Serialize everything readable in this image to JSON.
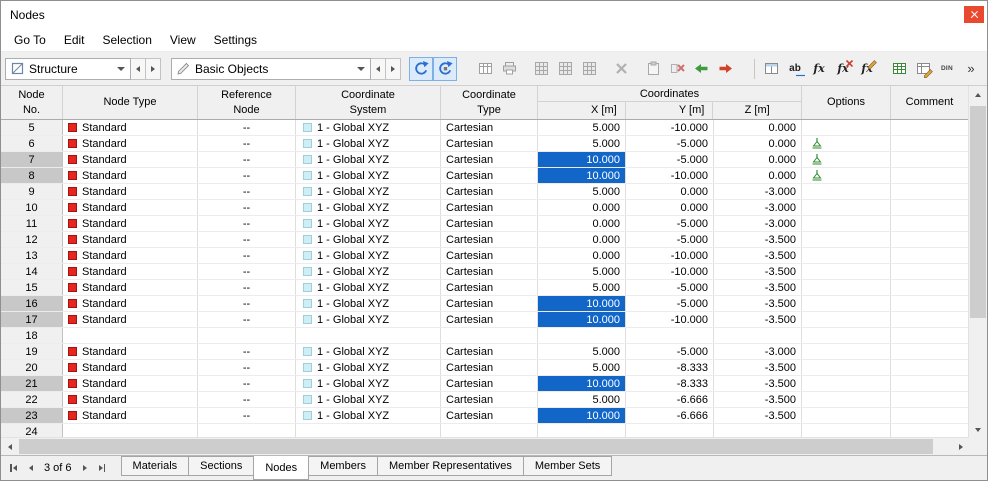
{
  "window": {
    "title": "Nodes"
  },
  "menu": {
    "items": [
      "Go To",
      "Edit",
      "Selection",
      "View",
      "Settings"
    ]
  },
  "toolbar": {
    "structure_select": {
      "value": "Structure"
    },
    "objects_select": {
      "value": "Basic Objects"
    },
    "glyphs": {
      "rename": "ab",
      "formula": "fx",
      "din": "DIN",
      "overflow": "»"
    },
    "icon_names": [
      "sync-selection",
      "sync-view",
      "table-layout",
      "print",
      "grid-block-1",
      "grid-block-2",
      "grid-block-3",
      "clear",
      "paste",
      "delete-rows",
      "import-rows",
      "export-rows",
      "split-table",
      "rename",
      "formula",
      "formula-delete",
      "formula-edit",
      "excel-export",
      "table-edit",
      "din",
      "overflow"
    ]
  },
  "table": {
    "header": {
      "node_no": [
        "Node",
        "No."
      ],
      "node_type": "Node Type",
      "reference_node": [
        "Reference",
        "Node"
      ],
      "coordinate_system": [
        "Coordinate",
        "System"
      ],
      "coordinate_type": [
        "Coordinate",
        "Type"
      ],
      "coordinates_group": "Coordinates",
      "x": "X [m]",
      "y": "Y [m]",
      "z": "Z [m]",
      "options": "Options",
      "comment": "Comment"
    },
    "rows": [
      {
        "no": "5",
        "type": "Standard",
        "ref": "--",
        "system": "1 - Global XYZ",
        "ctype": "Cartesian",
        "x": "5.000",
        "y": "-10.000",
        "z": "0.000",
        "xsel": false,
        "opt": false,
        "sel": false
      },
      {
        "no": "6",
        "type": "Standard",
        "ref": "--",
        "system": "1 - Global XYZ",
        "ctype": "Cartesian",
        "x": "5.000",
        "y": "-5.000",
        "z": "0.000",
        "xsel": false,
        "opt": true,
        "sel": false
      },
      {
        "no": "7",
        "type": "Standard",
        "ref": "--",
        "system": "1 - Global XYZ",
        "ctype": "Cartesian",
        "x": "10.000",
        "y": "-5.000",
        "z": "0.000",
        "xsel": true,
        "opt": true,
        "sel": true
      },
      {
        "no": "8",
        "type": "Standard",
        "ref": "--",
        "system": "1 - Global XYZ",
        "ctype": "Cartesian",
        "x": "10.000",
        "y": "-10.000",
        "z": "0.000",
        "xsel": true,
        "opt": true,
        "sel": true
      },
      {
        "no": "9",
        "type": "Standard",
        "ref": "--",
        "system": "1 - Global XYZ",
        "ctype": "Cartesian",
        "x": "5.000",
        "y": "0.000",
        "z": "-3.000",
        "xsel": false,
        "opt": false,
        "sel": false
      },
      {
        "no": "10",
        "type": "Standard",
        "ref": "--",
        "system": "1 - Global XYZ",
        "ctype": "Cartesian",
        "x": "0.000",
        "y": "0.000",
        "z": "-3.000",
        "xsel": false,
        "opt": false,
        "sel": false
      },
      {
        "no": "11",
        "type": "Standard",
        "ref": "--",
        "system": "1 - Global XYZ",
        "ctype": "Cartesian",
        "x": "0.000",
        "y": "-5.000",
        "z": "-3.000",
        "xsel": false,
        "opt": false,
        "sel": false
      },
      {
        "no": "12",
        "type": "Standard",
        "ref": "--",
        "system": "1 - Global XYZ",
        "ctype": "Cartesian",
        "x": "0.000",
        "y": "-5.000",
        "z": "-3.500",
        "xsel": false,
        "opt": false,
        "sel": false
      },
      {
        "no": "13",
        "type": "Standard",
        "ref": "--",
        "system": "1 - Global XYZ",
        "ctype": "Cartesian",
        "x": "0.000",
        "y": "-10.000",
        "z": "-3.500",
        "xsel": false,
        "opt": false,
        "sel": false
      },
      {
        "no": "14",
        "type": "Standard",
        "ref": "--",
        "system": "1 - Global XYZ",
        "ctype": "Cartesian",
        "x": "5.000",
        "y": "-10.000",
        "z": "-3.500",
        "xsel": false,
        "opt": false,
        "sel": false
      },
      {
        "no": "15",
        "type": "Standard",
        "ref": "--",
        "system": "1 - Global XYZ",
        "ctype": "Cartesian",
        "x": "5.000",
        "y": "-5.000",
        "z": "-3.500",
        "xsel": false,
        "opt": false,
        "sel": false
      },
      {
        "no": "16",
        "type": "Standard",
        "ref": "--",
        "system": "1 - Global XYZ",
        "ctype": "Cartesian",
        "x": "10.000",
        "y": "-5.000",
        "z": "-3.500",
        "xsel": true,
        "opt": false,
        "sel": true
      },
      {
        "no": "17",
        "type": "Standard",
        "ref": "--",
        "system": "1 - Global XYZ",
        "ctype": "Cartesian",
        "x": "10.000",
        "y": "-10.000",
        "z": "-3.500",
        "xsel": true,
        "opt": false,
        "sel": true
      },
      {
        "no": "18",
        "type": "",
        "ref": "",
        "system": "",
        "ctype": "",
        "x": "",
        "y": "",
        "z": "",
        "xsel": false,
        "opt": false,
        "sel": false
      },
      {
        "no": "19",
        "type": "Standard",
        "ref": "--",
        "system": "1 - Global XYZ",
        "ctype": "Cartesian",
        "x": "5.000",
        "y": "-5.000",
        "z": "-3.000",
        "xsel": false,
        "opt": false,
        "sel": false
      },
      {
        "no": "20",
        "type": "Standard",
        "ref": "--",
        "system": "1 - Global XYZ",
        "ctype": "Cartesian",
        "x": "5.000",
        "y": "-8.333",
        "z": "-3.500",
        "xsel": false,
        "opt": false,
        "sel": false
      },
      {
        "no": "21",
        "type": "Standard",
        "ref": "--",
        "system": "1 - Global XYZ",
        "ctype": "Cartesian",
        "x": "10.000",
        "y": "-8.333",
        "z": "-3.500",
        "xsel": true,
        "opt": false,
        "sel": true
      },
      {
        "no": "22",
        "type": "Standard",
        "ref": "--",
        "system": "1 - Global XYZ",
        "ctype": "Cartesian",
        "x": "5.000",
        "y": "-6.666",
        "z": "-3.500",
        "xsel": false,
        "opt": false,
        "sel": false
      },
      {
        "no": "23",
        "type": "Standard",
        "ref": "--",
        "system": "1 - Global XYZ",
        "ctype": "Cartesian",
        "x": "10.000",
        "y": "-6.666",
        "z": "-3.500",
        "xsel": true,
        "opt": false,
        "sel": true
      },
      {
        "no": "24",
        "type": "",
        "ref": "",
        "system": "",
        "ctype": "",
        "x": "",
        "y": "",
        "z": "",
        "xsel": false,
        "opt": false,
        "sel": false
      }
    ]
  },
  "bottom": {
    "position": "3 of 6",
    "tabs": [
      {
        "label": "Materials",
        "active": false
      },
      {
        "label": "Sections",
        "active": false
      },
      {
        "label": "Nodes",
        "active": true
      },
      {
        "label": "Members",
        "active": false
      },
      {
        "label": "Member Representatives",
        "active": false
      },
      {
        "label": "Member Sets",
        "active": false
      }
    ]
  },
  "colors": {
    "selection_blue": "#1166c8",
    "node_type_red": "#e8251d",
    "coordinate_system_cyan": "#cdeef4",
    "close_button_red": "#e8492f",
    "toggle_blue_bg": "#dcebfc"
  }
}
